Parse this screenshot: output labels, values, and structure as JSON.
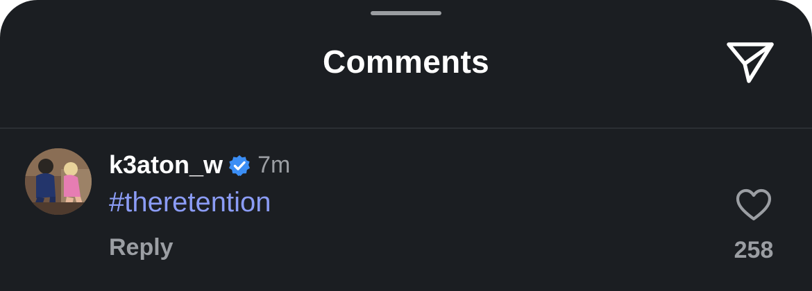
{
  "sheet": {
    "title": "Comments",
    "share_icon": "paper-plane-icon"
  },
  "comment": {
    "username": "k3aton_w",
    "verified": true,
    "verified_icon": "verified-badge-icon",
    "timestamp": "7m",
    "text": "#theretention",
    "reply_label": "Reply",
    "like_icon": "heart-outline-icon",
    "like_count": "258"
  },
  "colors": {
    "background": "#1b1e22",
    "hashtag": "#8b9cf5",
    "verified": "#3b8ef5",
    "muted_text": "#9b9ea3"
  }
}
